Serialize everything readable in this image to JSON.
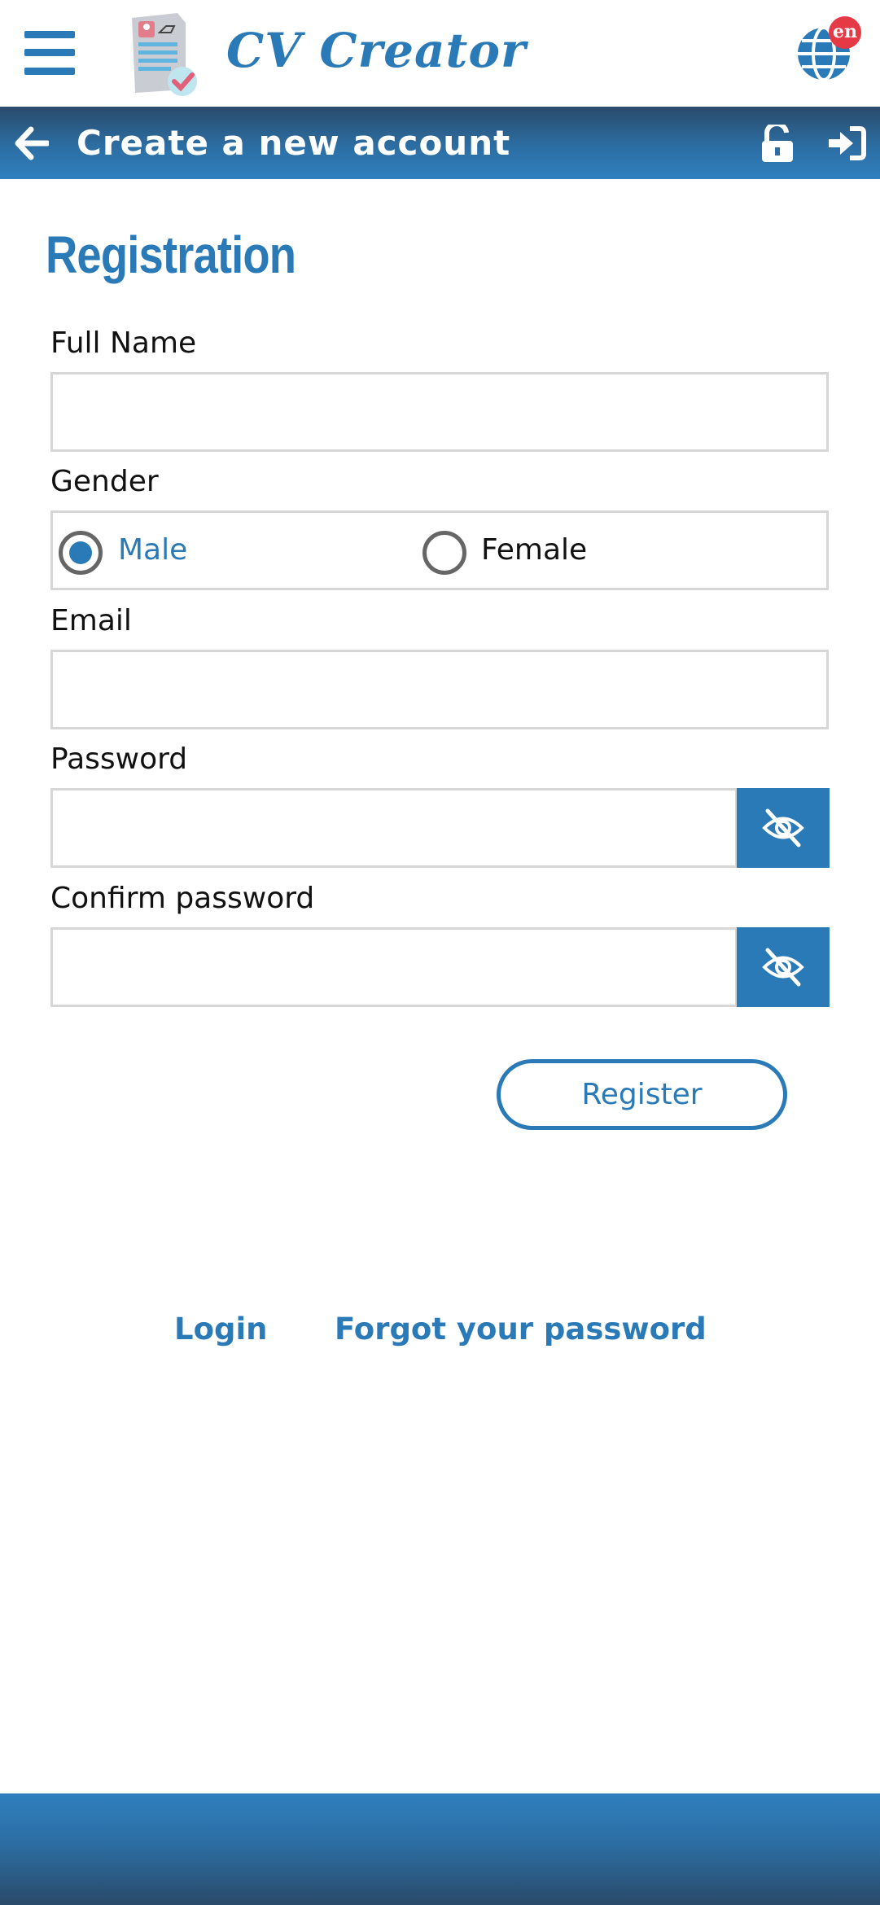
{
  "header": {
    "app_name": "CV Creator",
    "language_badge": "en",
    "icons": [
      "menu-icon",
      "cv-document-logo",
      "globe-icon"
    ]
  },
  "titlebar": {
    "title": "Create a new account",
    "icons": [
      "arrow-left-icon",
      "unlock-icon",
      "sign-in-icon"
    ]
  },
  "form": {
    "heading": "Registration",
    "full_name": {
      "label": "Full Name",
      "value": ""
    },
    "gender": {
      "label": "Gender",
      "options": [
        "Male",
        "Female"
      ],
      "selected": "Male"
    },
    "email": {
      "label": "Email",
      "value": ""
    },
    "password": {
      "label": "Password",
      "value": ""
    },
    "confirm_password": {
      "label": "Confirm password",
      "value": ""
    },
    "register_label": "Register"
  },
  "links": {
    "login": "Login",
    "forgot": "Forgot your password"
  },
  "colors": {
    "accent": "#2a7ab8",
    "badge": "#e53945",
    "bar_dark": "#2a4a6a"
  }
}
